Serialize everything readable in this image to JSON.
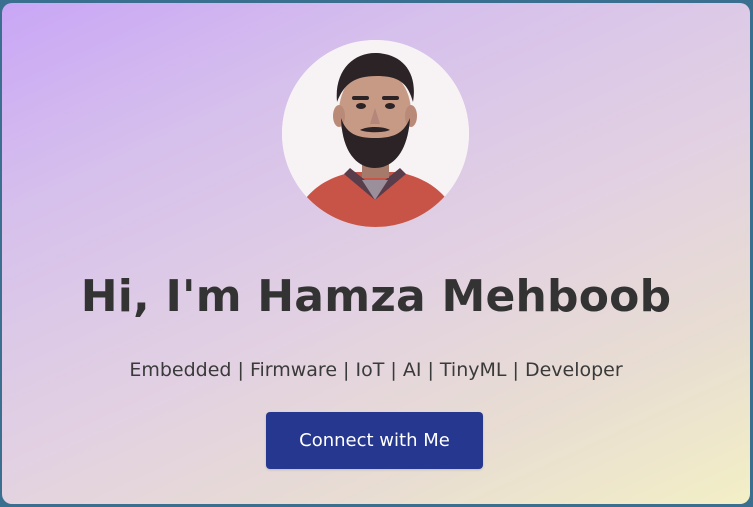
{
  "hero": {
    "avatar_alt": "Profile photo",
    "heading": "Hi, I'm Hamza Mehboob",
    "tagline": "Embedded | Firmware | IoT | AI | TinyML | Developer",
    "cta_label": "Connect with Me"
  },
  "colors": {
    "accent": "#26378f",
    "heading_text": "#333333",
    "gradient_start": "#c9a6f6",
    "gradient_end": "#f3efc6"
  }
}
